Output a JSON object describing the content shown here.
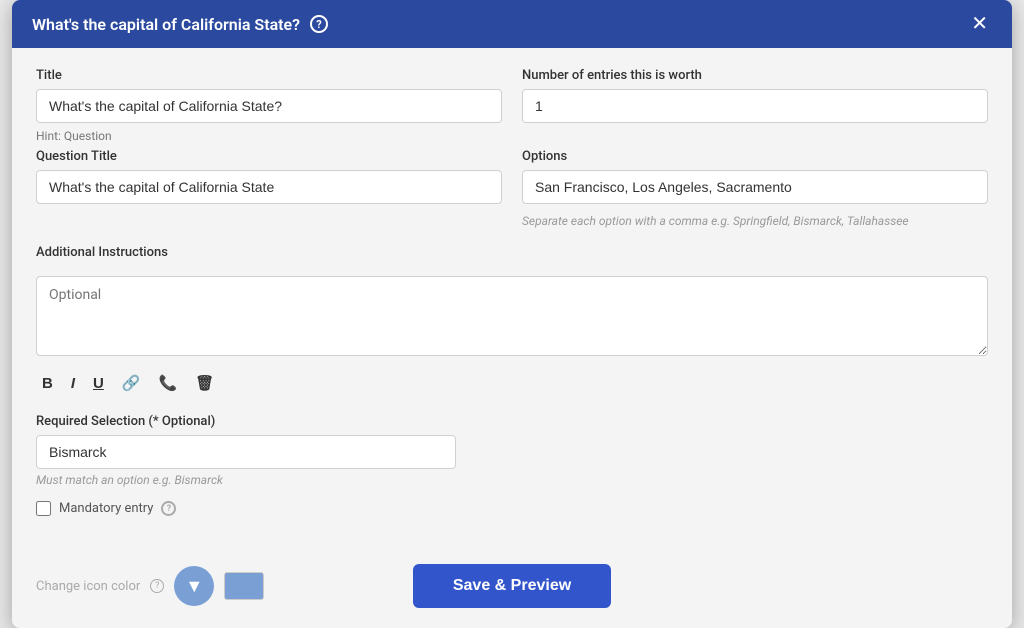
{
  "modal": {
    "title": "What's the capital of California State?",
    "close_label": "✕"
  },
  "header_help_icon": "?",
  "form": {
    "title_label": "Title",
    "title_value": "What's the capital of California State?",
    "title_placeholder": "",
    "hint_text": "Hint: Question",
    "entries_label": "Number of entries this is worth",
    "entries_value": "1",
    "question_title_label": "Question Title",
    "question_title_value": "What's the capital of California State",
    "options_label": "Options",
    "options_value": "San Francisco, Los Angeles, Sacramento",
    "options_hint": "Separate each option with a comma e.g. Springfield, Bismarck, Tallahassee",
    "additional_instructions_label": "Additional Instructions",
    "additional_instructions_placeholder": "Optional",
    "required_selection_label": "Required Selection (* Optional)",
    "required_selection_value": "Bismarck",
    "required_selection_hint": "Must match an option e.g. Bismarck",
    "mandatory_label": "Mandatory entry",
    "change_icon_label": "Change icon color"
  },
  "toolbar": {
    "bold": "B",
    "italic": "I",
    "underline": "U",
    "link": "🔗",
    "phone": "📞",
    "delete": "🗑"
  },
  "footer": {
    "save_preview_label": "Save & Preview"
  }
}
